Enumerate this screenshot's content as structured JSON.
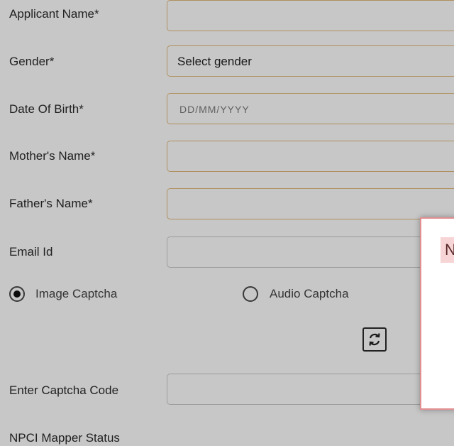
{
  "form": {
    "applicant_name_label": "Applicant Name*",
    "gender_label": "Gender*",
    "gender_value": "Select gender",
    "dob_label": "Date Of Birth*",
    "dob_placeholder": "DD/MM/YYYY",
    "mother_name_label": "Mother's Name*",
    "father_name_label": "Father's Name*",
    "email_label": "Email Id",
    "captcha_options": [
      {
        "label": "Image Captcha",
        "selected": true
      },
      {
        "label": "Audio Captcha",
        "selected": false
      }
    ],
    "refresh_icon": "refresh-icon",
    "captcha_code_label": "Enter Captcha Code",
    "npci_label": "NPCI Mapper Status"
  },
  "modal": {
    "heading_fragment": "N"
  },
  "colors": {
    "required_border": "#e3b97a",
    "plain_border": "#c8c8c8",
    "modal_border": "#e38f92",
    "modal_heading_bg": "#f7d4d5"
  }
}
